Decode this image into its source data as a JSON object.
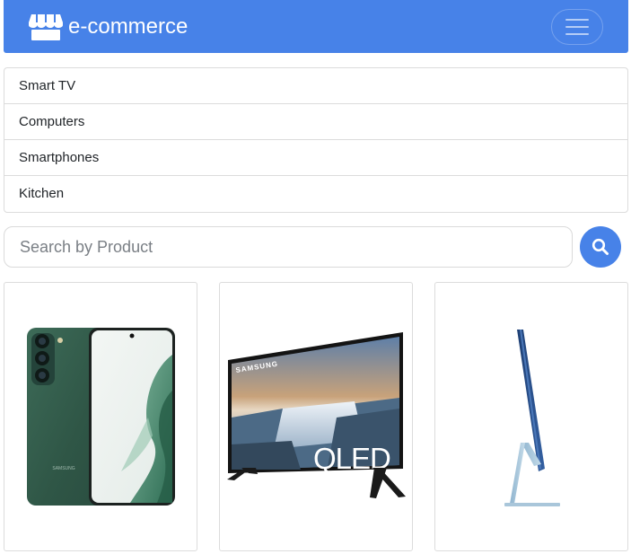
{
  "navbar": {
    "brand_text": "e-commerce",
    "brand_icon": "store-icon",
    "menu_icon": "hamburger-menu-icon",
    "color": "#4782e8"
  },
  "categories": [
    {
      "label": "Smart TV"
    },
    {
      "label": "Computers"
    },
    {
      "label": "Smartphones"
    },
    {
      "label": "Kitchen"
    }
  ],
  "search": {
    "placeholder": "Search by Product",
    "value": "",
    "icon": "search-icon"
  },
  "products": [
    {
      "image": "smartphone-image",
      "brand_text": "SAMSUNG"
    },
    {
      "image": "smart-tv-image",
      "brand_text": "SAMSUNG",
      "badge_text": "QLED"
    },
    {
      "image": "all-in-one-computer-image"
    }
  ]
}
